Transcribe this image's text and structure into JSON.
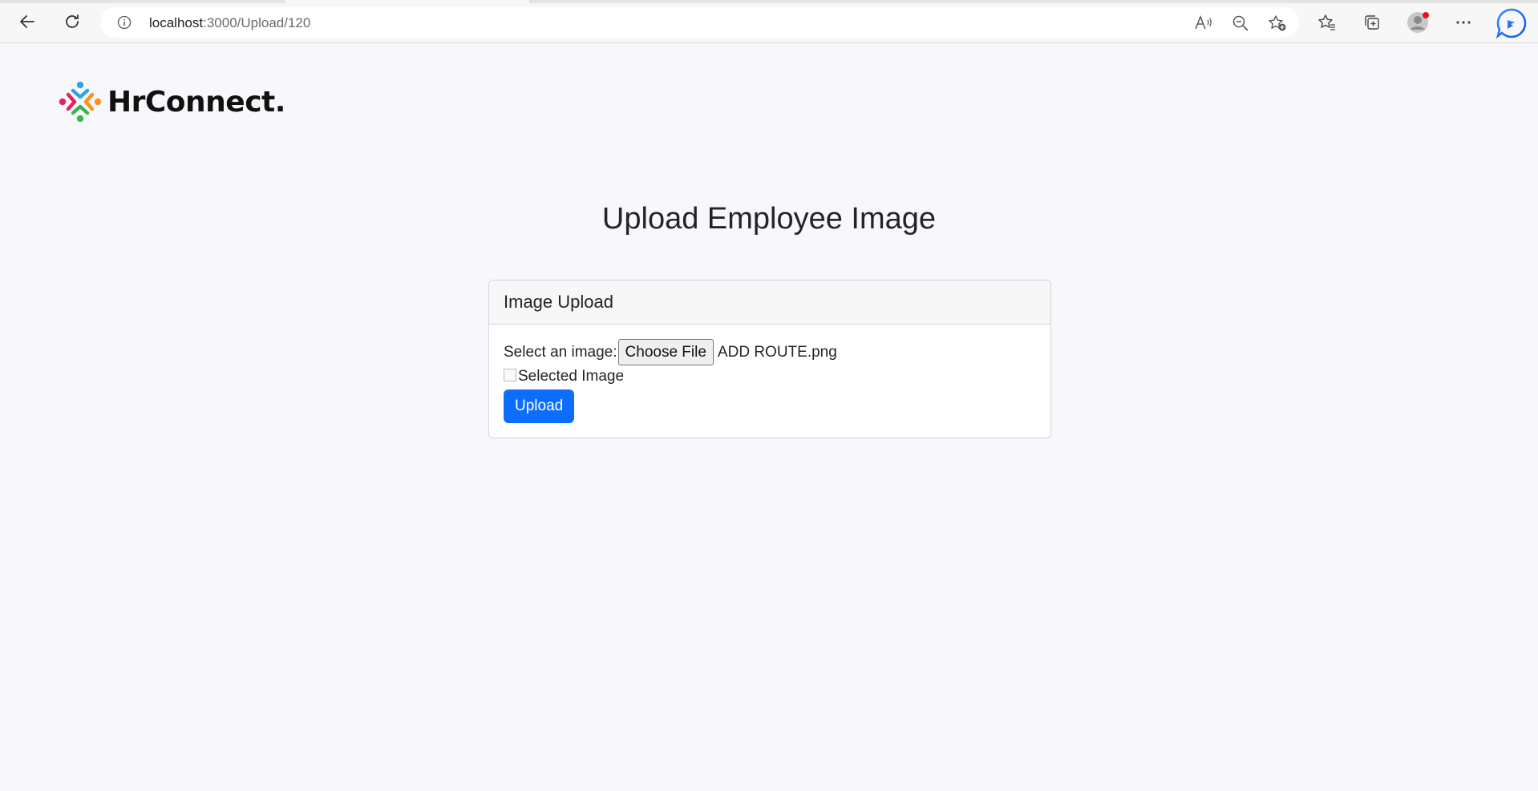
{
  "browser": {
    "url_host": "localhost",
    "url_rest": ":3000/Upload/120"
  },
  "logo": {
    "text": "HrConnect."
  },
  "page": {
    "title": "Upload Employee Image"
  },
  "card": {
    "header": "Image Upload",
    "select_label": "Select an image:",
    "choose_file_label": "Choose File",
    "selected_file_name": "ADD ROUTE.png",
    "image_alt": "Selected Image",
    "upload_button_label": "Upload"
  },
  "colors": {
    "primary": "#0d6efd",
    "page_background": "#f8f8fc",
    "notification_dot": "#e81123"
  }
}
